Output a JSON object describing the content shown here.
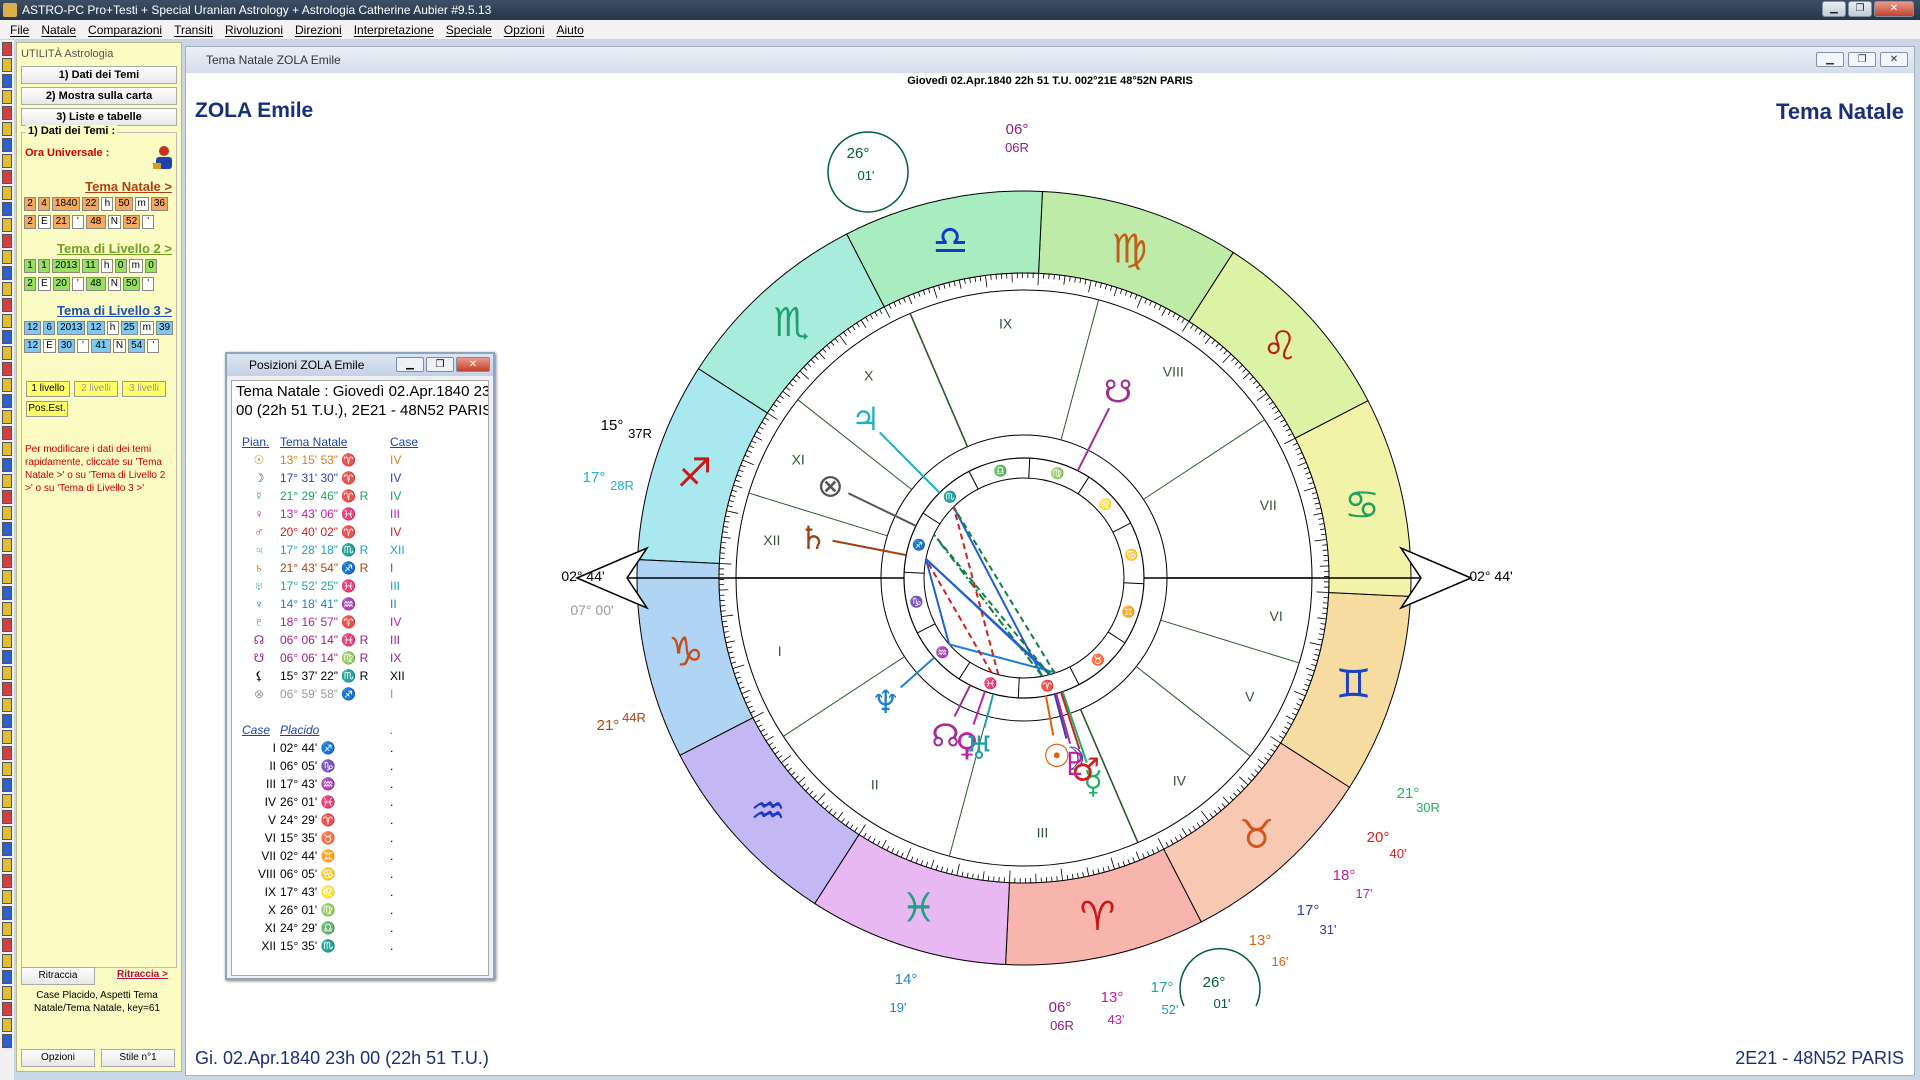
{
  "window": {
    "title": "ASTRO-PC Pro+Testi + Special Uranian Astrology + Astrologia Catherine Aubier #9.5.13"
  },
  "menu": [
    "File",
    "Natale",
    "Comparazioni",
    "Transiti",
    "Rivoluzioni",
    "Direzioni",
    "Interpretazione",
    "Speciale",
    "Opzioni",
    "Aiuto"
  ],
  "sidebar": {
    "title": "UTILITÀ Astrologia",
    "buttons": [
      "1) Dati dei Temi",
      "2) Mostra sulla carta",
      "3) Liste e tabelle"
    ],
    "group_label": "1) Dati dei Temi :",
    "ora_label": "Ora Universale :",
    "natale_link": "Tema Natale >",
    "natale_row1": [
      "2",
      "4",
      "1840",
      "22",
      "h",
      "50",
      "m",
      "36"
    ],
    "natale_row2": [
      "2",
      "E",
      "21",
      "'",
      "48",
      "N",
      "52",
      "'"
    ],
    "livello2_link": "Tema di Livello 2 >",
    "livello2_row1": [
      "1",
      "1",
      "2013",
      "11",
      "h",
      "0",
      "m",
      "0"
    ],
    "livello2_row2": [
      "2",
      "E",
      "20",
      "'",
      "48",
      "N",
      "50",
      "'"
    ],
    "livello3_link": "Tema di Livello 3 >",
    "livello3_row1": [
      "12",
      "6",
      "2013",
      "12",
      "h",
      "25",
      "m",
      "39"
    ],
    "livello3_row2": [
      "12",
      "E",
      "30",
      "'",
      "41",
      "N",
      "54",
      "'"
    ],
    "levels": [
      "1 livello",
      "2 livelli",
      "3 livelli"
    ],
    "posest": "Pos.Est.",
    "note": "Per modificare i dati dei temi rapidamente, cliccate su 'Tema Natale >' o su 'Tema di Livello 2 >' o su 'Tema di Livello 3 >'",
    "ritraccia_btn": "Ritraccia",
    "ritraccia_link": "Ritraccia >",
    "status": "Case Placido, Aspetti Tema Natale/Tema Natale, key=61",
    "opzioni": "Opzioni",
    "stile": "Stile n°1"
  },
  "chart_window": {
    "title": "Tema Natale  ZOLA Emile",
    "header": "Giovedì 02.Apr.1840 22h 51 T.U. 002°21E 48°52N  PARIS",
    "name": "ZOLA Emile",
    "type": "Tema Natale",
    "footer_left": "Gi. 02.Apr.1840 23h 00 (22h 51 T.U.)",
    "footer_right": "2E21 - 48N52  PARIS"
  },
  "wheel": {
    "asc_deg": 272.73,
    "signs": [
      {
        "glyph": "♈",
        "color": "#f7b5ad",
        "text": "#c81818"
      },
      {
        "glyph": "♉",
        "color": "#f9c8b2",
        "text": "#d05820"
      },
      {
        "glyph": "♊",
        "color": "#f6dca0",
        "text": "#1840c8"
      },
      {
        "glyph": "♋",
        "color": "#f2f2a8",
        "text": "#20a060"
      },
      {
        "glyph": "♌",
        "color": "#dcf2a4",
        "text": "#c01818"
      },
      {
        "glyph": "♍",
        "color": "#bfeba8",
        "text": "#c06018"
      },
      {
        "glyph": "♎",
        "color": "#a8ecc0",
        "text": "#1838c8"
      },
      {
        "glyph": "♏",
        "color": "#a8ecdc",
        "text": "#20a070"
      },
      {
        "glyph": "♐",
        "color": "#a8e8ee",
        "text": "#c81818"
      },
      {
        "glyph": "♑",
        "color": "#b0d4f4",
        "text": "#c05018"
      },
      {
        "glyph": "♒",
        "color": "#c4b8f4",
        "text": "#2038c8"
      },
      {
        "glyph": "♓",
        "color": "#e8b8f2",
        "text": "#20a080"
      }
    ],
    "cusps": [
      {
        "house": "I",
        "lon": 272.73
      },
      {
        "house": "II",
        "lon": 306.08
      },
      {
        "house": "III",
        "lon": 347.72
      },
      {
        "house": "IV",
        "lon": 26.02
      },
      {
        "house": "V",
        "lon": 54.48
      },
      {
        "house": "VI",
        "lon": 75.58
      },
      {
        "house": "VII",
        "lon": 92.73
      },
      {
        "house": "VIII",
        "lon": 126.08
      },
      {
        "house": "IX",
        "lon": 167.72
      },
      {
        "house": "X",
        "lon": 206.02
      },
      {
        "house": "XI",
        "lon": 234.48
      },
      {
        "house": "XII",
        "lon": 255.58
      }
    ],
    "planets": [
      {
        "glyph": "☉",
        "lon": 13.26,
        "color": "#e06010"
      },
      {
        "glyph": "☽",
        "lon": 17.53,
        "color": "#3040b0"
      },
      {
        "glyph": "☿",
        "lon": 21.5,
        "color": "#20b060"
      },
      {
        "glyph": "♀",
        "lon": 343.72,
        "color": "#c020a0"
      },
      {
        "glyph": "♂",
        "lon": 20.67,
        "color": "#d02020"
      },
      {
        "glyph": "♃",
        "lon": 227.47,
        "color": "#20b0c0"
      },
      {
        "glyph": "♄",
        "lon": 261.73,
        "color": "#a04010"
      },
      {
        "glyph": "♅",
        "lon": 347.87,
        "color": "#20a0a0"
      },
      {
        "glyph": "♆",
        "lon": 314.31,
        "color": "#2080d0"
      },
      {
        "glyph": "♇",
        "lon": 18.28,
        "color": "#c020a0"
      },
      {
        "glyph": "☊",
        "lon": 336.1,
        "color": "#a03090"
      },
      {
        "glyph": "☋",
        "lon": 156.1,
        "color": "#a03090"
      },
      {
        "glyph": "⊗",
        "lon": 246.98,
        "color": "#555555"
      }
    ]
  },
  "positions": {
    "title": "Posizioni  ZOLA Emile",
    "line1": "Tema Natale : Giovedì 02.Apr.1840 23h",
    "line2": "00 (22h 51 T.U.), 2E21 - 48N52  PARIS",
    "headers": [
      "Pian.",
      "Tema Natale",
      "Case"
    ],
    "planets": [
      {
        "g": "☉",
        "pos": "13° 15' 53\" ♈",
        "house": "IV",
        "color": "#e08020"
      },
      {
        "g": "☽",
        "pos": "17° 31' 30\" ♈",
        "house": "IV",
        "color": "#3040b0"
      },
      {
        "g": "☿",
        "pos": "21° 29' 46\" ♈ R",
        "house": "IV",
        "color": "#20a060"
      },
      {
        "g": "♀",
        "pos": "13° 43' 06\" ♓",
        "house": "III",
        "color": "#c020a0"
      },
      {
        "g": "♂",
        "pos": "20° 40' 02\" ♈",
        "house": "IV",
        "color": "#d02020"
      },
      {
        "g": "♃",
        "pos": "17° 28' 18\" ♏ R",
        "house": "XII",
        "color": "#20a0c0"
      },
      {
        "g": "♄",
        "pos": "21° 43' 54\" ♐ R",
        "house": "I",
        "color": "#b04010"
      },
      {
        "g": "♅",
        "pos": "17° 52' 25\" ♓",
        "house": "III",
        "color": "#20a0a0"
      },
      {
        "g": "♆",
        "pos": "14° 18' 41\" ♒",
        "house": "II",
        "color": "#2080d0"
      },
      {
        "g": "♇",
        "pos": "18° 16' 57\" ♈",
        "house": "IV",
        "color": "#b02090"
      },
      {
        "g": "☊",
        "pos": "06° 06' 14\" ♓ R",
        "house": "III",
        "color": "#a02080"
      },
      {
        "g": "☋",
        "pos": "06° 06' 14\" ♍ R",
        "house": "IX",
        "color": "#a02080"
      },
      {
        "g": "⚸",
        "pos": "15° 37' 22\" ♏ R",
        "house": "XII",
        "color": "#000000"
      },
      {
        "g": "⊗",
        "pos": "06° 59' 58\" ♐",
        "house": "I",
        "color": "#999999"
      }
    ],
    "case_headers": [
      "Case",
      "Placido"
    ],
    "houses": [
      {
        "h": "I",
        "pos": "02° 44' ♐"
      },
      {
        "h": "II",
        "pos": "06° 05' ♑"
      },
      {
        "h": "III",
        "pos": "17° 43' ♒"
      },
      {
        "h": "IV",
        "pos": "26° 01' ♓"
      },
      {
        "h": "V",
        "pos": "24° 29' ♈"
      },
      {
        "h": "VI",
        "pos": "15° 35' ♉"
      },
      {
        "h": "VII",
        "pos": "02° 44' ♊"
      },
      {
        "h": "VIII",
        "pos": "06° 05' ♋"
      },
      {
        "h": "IX",
        "pos": "17° 43' ♌"
      },
      {
        "h": "X",
        "pos": "26° 01' ♍"
      },
      {
        "h": "XI",
        "pos": "24° 29' ♎"
      },
      {
        "h": "XII",
        "pos": "15° 35' ♏"
      }
    ]
  },
  "chart_labels": {
    "mc_top": "06°",
    "mc_top2": "06R",
    "asc_left": "02° 44'",
    "asc_right": "02° 44'",
    "circle_top": "26°",
    "circle_top2": "01'",
    "circle_bot": "26°",
    "circle_bot2": "01'",
    "l_15": "15°",
    "l_37r": "37R",
    "l_17": "17°",
    "l_28r": "28R",
    "l_07": "07° 00'",
    "l_21": "21°",
    "l_44r": "44R",
    "r_21": "21°",
    "r_30r": "30R",
    "r_20": "20°",
    "r_40": "40'",
    "r_18": "18°",
    "r_17": "17'",
    "r_17b": "17°",
    "r_31": "31'",
    "r_13": "13°",
    "r_16": "16'",
    "b_14": "14°",
    "b_19": "19'",
    "b_06": "06°",
    "b_06r": "06R",
    "b_13": "13°",
    "b_43": "43'",
    "b_17": "17°",
    "b_52": "52'"
  }
}
